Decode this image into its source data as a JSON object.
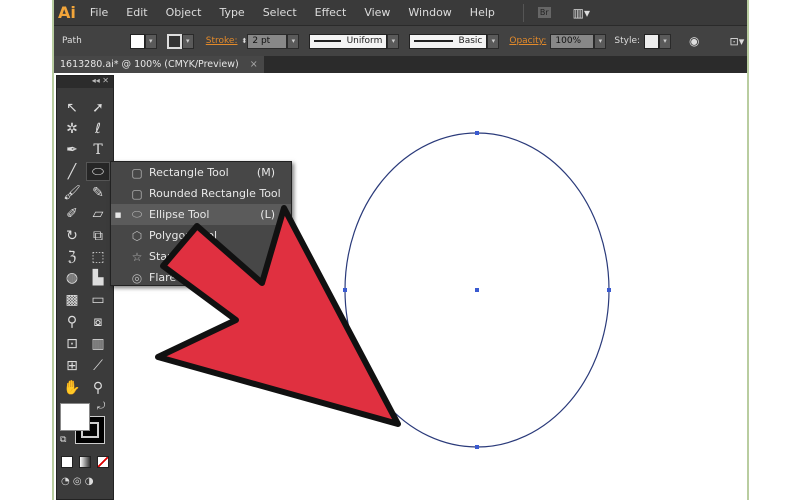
{
  "app": {
    "logo": "Ai"
  },
  "menubar": {
    "items": [
      "File",
      "Edit",
      "Object",
      "Type",
      "Select",
      "Effect",
      "View",
      "Window",
      "Help"
    ],
    "bridge": "Br"
  },
  "control": {
    "selection": "Path",
    "stroke_label": "Stroke:",
    "stroke_value": "2 pt",
    "profile": "Uniform",
    "brush": "Basic",
    "opacity_label": "Opacity:",
    "opacity_value": "100%",
    "style_label": "Style:"
  },
  "document": {
    "tab": "1613280.ai* @ 100% (CMYK/Preview)",
    "close": "×"
  },
  "popup": {
    "items": [
      {
        "label": "Rectangle Tool",
        "shortcut": "(M)",
        "icon": "rectangle-icon"
      },
      {
        "label": "Rounded Rectangle Tool",
        "shortcut": "",
        "icon": "rounded-rectangle-icon"
      },
      {
        "label": "Ellipse Tool",
        "shortcut": "(L)",
        "icon": "ellipse-icon",
        "active": true
      },
      {
        "label": "Polygon Tool",
        "shortcut": "",
        "icon": "polygon-icon"
      },
      {
        "label": "Star Tool",
        "shortcut": "",
        "icon": "star-icon"
      },
      {
        "label": "Flare Tool",
        "shortcut": "",
        "icon": "flare-icon"
      }
    ]
  },
  "colors": {
    "arrow": "#e03040",
    "ellipse_stroke": "#2a3a7a",
    "accent": "#e38a2a"
  }
}
